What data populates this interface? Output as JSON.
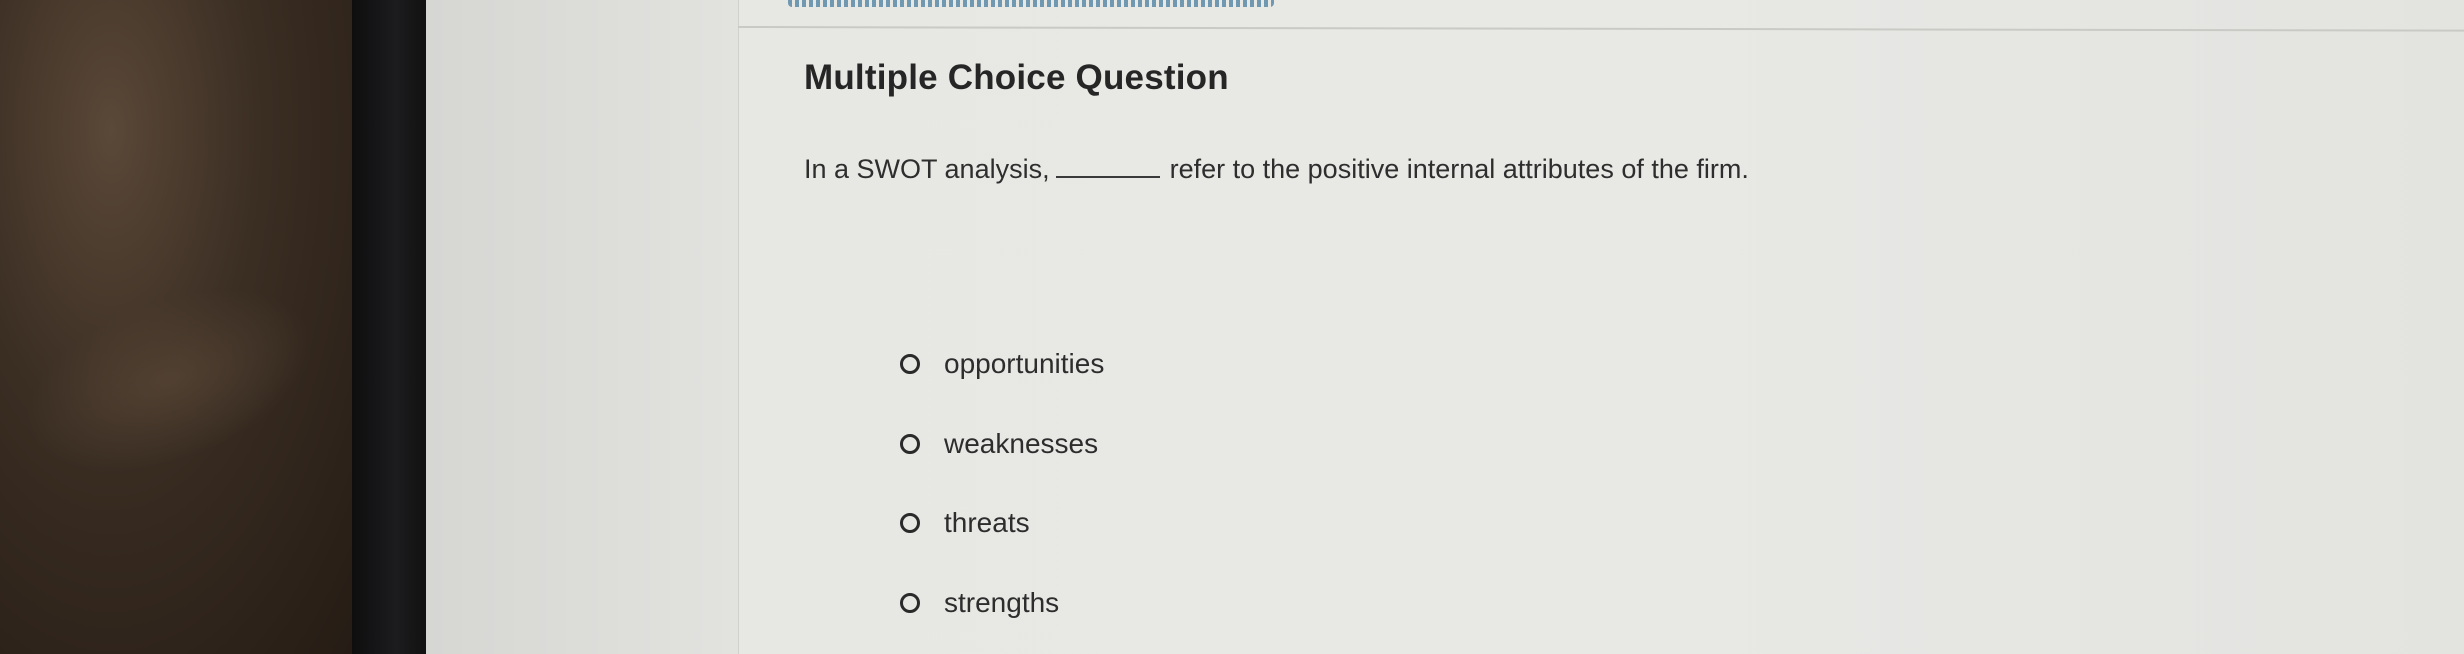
{
  "question": {
    "title": "Multiple Choice Question",
    "prompt_before_blank": "In a SWOT analysis,",
    "prompt_after_blank": "refer to the positive internal attributes of the firm."
  },
  "options": [
    {
      "label": "opportunities",
      "selected": false
    },
    {
      "label": "weaknesses",
      "selected": false
    },
    {
      "label": "threats",
      "selected": false
    },
    {
      "label": "strengths",
      "selected": false
    }
  ]
}
